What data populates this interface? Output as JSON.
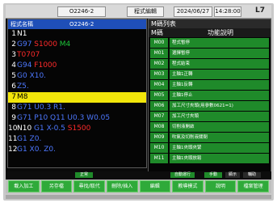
{
  "header": {
    "program_code": "O2246-2",
    "mode": "程式編輯",
    "date": "2024/06/27",
    "time": "14:28:00",
    "level": "L7"
  },
  "program": {
    "header_left": "程式名稱",
    "header_right": "O2246-2",
    "lines": [
      {
        "no": "1",
        "parts": [
          {
            "t": "N1",
            "c": "t-white"
          }
        ]
      },
      {
        "no": "2",
        "parts": [
          {
            "t": "G97 ",
            "c": "t-blue"
          },
          {
            "t": "S1000 ",
            "c": "t-red"
          },
          {
            "t": "M4",
            "c": "t-green"
          }
        ]
      },
      {
        "no": "3",
        "parts": [
          {
            "t": "T0707",
            "c": "t-red"
          }
        ]
      },
      {
        "no": "4",
        "parts": [
          {
            "t": "G94 ",
            "c": "t-blue"
          },
          {
            "t": "F1000",
            "c": "t-red"
          }
        ]
      },
      {
        "no": "5",
        "parts": [
          {
            "t": "G0 ",
            "c": "t-blue"
          },
          {
            "t": "X10.",
            "c": "t-blue"
          }
        ]
      },
      {
        "no": "6",
        "parts": [
          {
            "t": "Z5.",
            "c": "t-blue"
          }
        ]
      },
      {
        "no": "7",
        "parts": [
          {
            "t": "M8",
            "c": "t-white"
          }
        ],
        "selected": true
      },
      {
        "no": "8",
        "parts": [
          {
            "t": "G71 ",
            "c": "t-blue"
          },
          {
            "t": "U0.3 R1.",
            "c": "t-blue"
          }
        ]
      },
      {
        "no": "9",
        "parts": [
          {
            "t": "G71 P10 Q11 U0.3 W0.05",
            "c": "t-blue"
          }
        ]
      },
      {
        "no": "10",
        "parts": [
          {
            "t": "N10 ",
            "c": "t-white"
          },
          {
            "t": "G1 X-0.5 ",
            "c": "t-blue"
          },
          {
            "t": "S1500",
            "c": "t-red"
          }
        ]
      },
      {
        "no": "11",
        "parts": [
          {
            "t": "G1 Z0.",
            "c": "t-blue"
          }
        ]
      },
      {
        "no": "12",
        "parts": [
          {
            "t": "G1 X0. Z0.",
            "c": "t-blue"
          }
        ]
      }
    ]
  },
  "m_codes": {
    "title": "M碼列表",
    "col_code": "M碼",
    "col_desc": "功能說明",
    "rows": [
      {
        "code": "M00",
        "desc": "程式暫停"
      },
      {
        "code": "M01",
        "desc": "選擇暫停"
      },
      {
        "code": "M02",
        "desc": "程式結束"
      },
      {
        "code": "M03",
        "desc": "主軸1正轉"
      },
      {
        "code": "M04",
        "desc": "主軸1反轉"
      },
      {
        "code": "M05",
        "desc": "主軸1停止"
      },
      {
        "code": "M06",
        "desc": "加工尺寸夾頭(用參數0621=1)"
      },
      {
        "code": "M07",
        "desc": "加工尺寸夾頭"
      },
      {
        "code": "M08",
        "desc": "切削液開啟"
      },
      {
        "code": "M09",
        "desc": "吹氣及切削液關閉"
      },
      {
        "code": "M10",
        "desc": "主軸1夾頭夾緊"
      },
      {
        "code": "M11",
        "desc": "主軸1夾頭放鬆"
      }
    ]
  },
  "status": {
    "cell1": "正常",
    "cell2": "自動運行",
    "cell3": "手動",
    "cell4": "顯示",
    "cell5": "輔助"
  },
  "softkeys": [
    {
      "label": "載入加工"
    },
    {
      "label": "另存檔"
    },
    {
      "label": "尋找/取代"
    },
    {
      "label": "刪除/插入"
    },
    {
      "label": "編輯"
    },
    {
      "label": "教導模式"
    },
    {
      "label": "說明"
    },
    {
      "label": "檔案管理"
    }
  ]
}
